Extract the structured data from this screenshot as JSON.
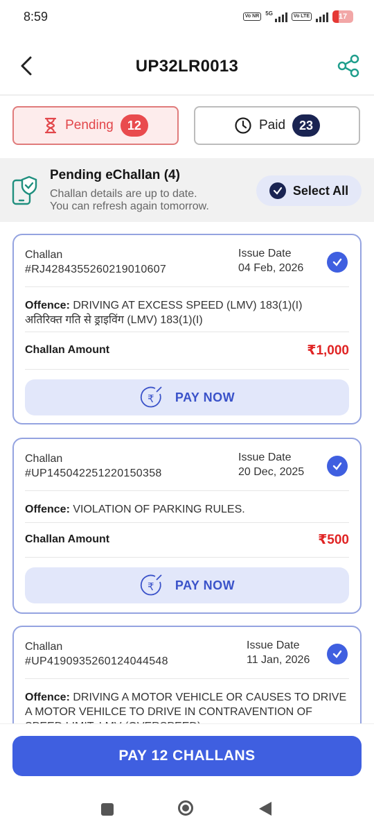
{
  "status_bar": {
    "time": "8:59",
    "network_badge_1": "Vo NR",
    "network_1": "5G",
    "network_badge_2": "Vo LTE",
    "battery": "17"
  },
  "header": {
    "title": "UP32LR0013",
    "back_icon": "chevron-left",
    "share_icon": "share"
  },
  "tabs": [
    {
      "label": "Pending",
      "count": "12",
      "icon": "hourglass",
      "active": true
    },
    {
      "label": "Paid",
      "count": "23",
      "icon": "clock",
      "active": false
    }
  ],
  "banner": {
    "heading": "Pending eChallan (4)",
    "line1": "Challan details are up to date.",
    "line2": "You can refresh again tomorrow.",
    "select_all": "Select All"
  },
  "challans": [
    {
      "challan_label": "Challan",
      "number": "#RJ4284355260219010607",
      "issue_label": "Issue Date",
      "issue_date": "04 Feb, 2026",
      "offence_label": "Offence:",
      "offence_text": "DRIVING AT EXCESS SPEED (LMV)   183(1)(I)",
      "offence_text_hi": "अतिरिक्त गति से ड्राइविंग (LMV)   183(1)(I)",
      "amount_label": "Challan Amount",
      "amount": "₹1,000",
      "pay_label": "PAY NOW",
      "selected": true
    },
    {
      "challan_label": "Challan",
      "number": "#UP145042251220150358",
      "issue_label": "Issue Date",
      "issue_date": "20 Dec, 2025",
      "offence_label": "Offence:",
      "offence_text": "VIOLATION OF PARKING RULES.",
      "amount_label": "Challan Amount",
      "amount": "₹500",
      "pay_label": "PAY NOW",
      "selected": true
    },
    {
      "challan_label": "Challan",
      "number": "#UP4190935260124044548",
      "issue_label": "Issue Date",
      "issue_date": "11 Jan, 2026",
      "offence_label": "Offence:",
      "offence_text": "DRIVING A MOTOR VEHICLE OR CAUSES TO DRIVE A MOTOR VEHILCE TO DRIVE IN CONTRAVENTION OF SPEED LIMIT. LMV (OVERSPEED)",
      "selected": true
    }
  ],
  "cta": {
    "label": "PAY 12 CHALLANS"
  },
  "colors": {
    "primary": "#3f5fe0",
    "pending_red": "#e94b4e",
    "amount_red": "#e02424",
    "navy": "#1a2452",
    "card_border": "#94a3e0"
  }
}
